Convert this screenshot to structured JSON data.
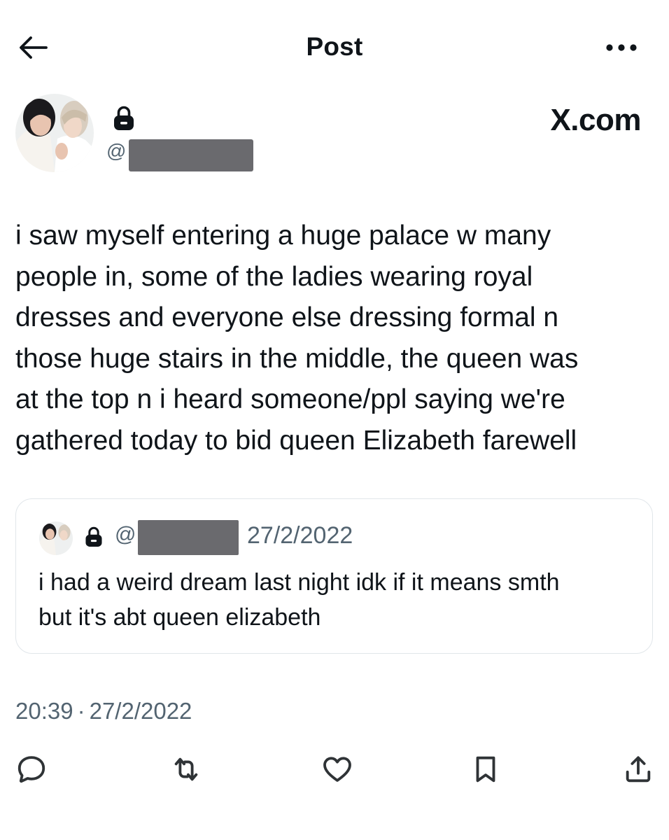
{
  "header": {
    "title": "Post",
    "back_icon": "arrow-left-icon",
    "more_icon": "more-horizontal-icon"
  },
  "author": {
    "handle_prefix": "@",
    "protected_icon": "lock-icon",
    "avatar": "profile-photo"
  },
  "watermark": "X.com",
  "post": {
    "text": "i saw myself entering a huge palace w many\npeople in, some of the ladies wearing royal\ndresses and everyone else dressing formal n\nthose huge stairs in the middle, the queen was\nat the top n i heard someone/ppl saying we're\ngathered today to bid queen Elizabeth farewell",
    "time": "20:39",
    "separator": "·",
    "date": "27/2/2022"
  },
  "quoted_post": {
    "handle_prefix": "@",
    "date": "27/2/2022",
    "text": "i had a weird dream last night idk if it means smth\nbut it's abt queen elizabeth"
  },
  "actions": [
    {
      "icon": "reply-icon"
    },
    {
      "icon": "repost-icon"
    },
    {
      "icon": "like-icon"
    },
    {
      "icon": "bookmark-icon"
    },
    {
      "icon": "share-icon"
    }
  ],
  "colors": {
    "text_primary": "#0f1419",
    "text_secondary": "#536471",
    "border": "#e1e6ea",
    "redaction": "#6a6a6e",
    "background": "#ffffff"
  }
}
